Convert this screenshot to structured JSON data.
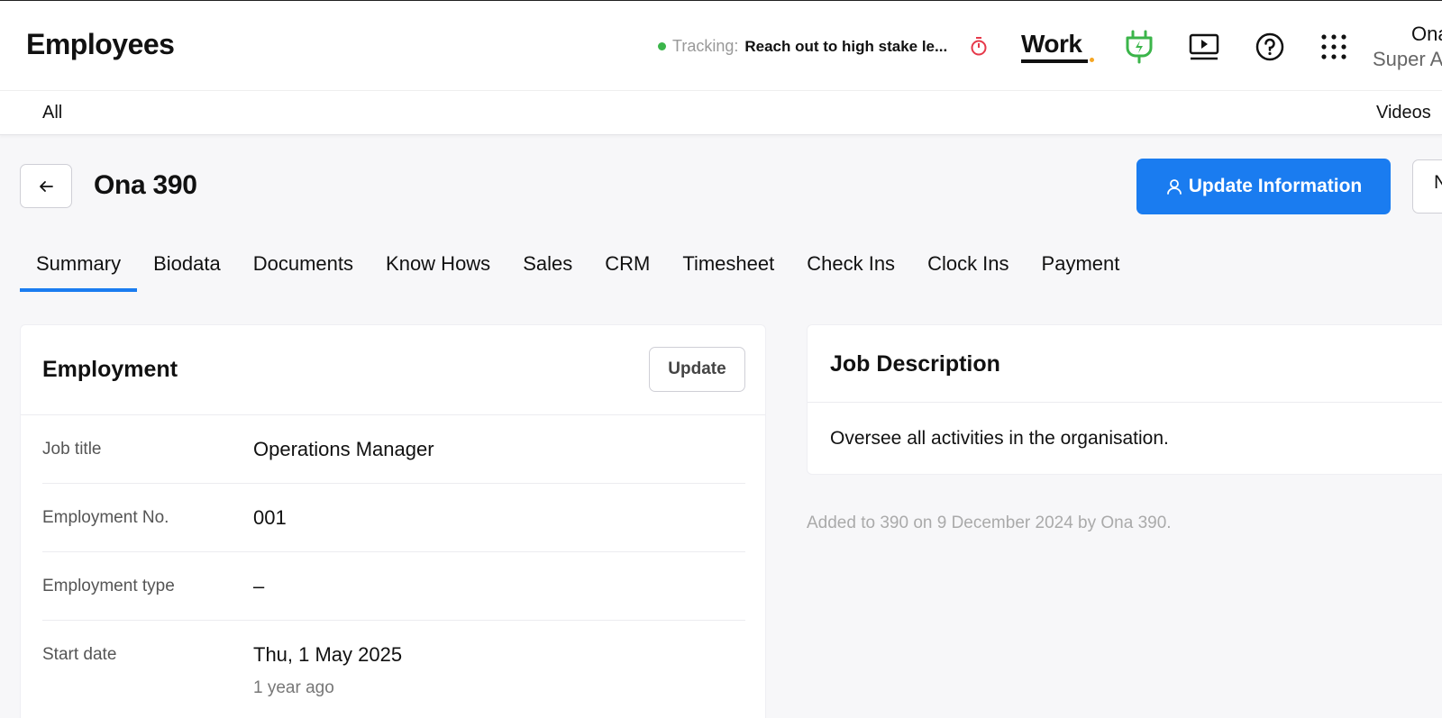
{
  "header": {
    "title": "Employees",
    "tracking_label": "Tracking:",
    "tracking_text": "Reach out to high stake le...",
    "work_logo": "Work",
    "user_name": "Ona",
    "user_role": "Super A"
  },
  "subnav": {
    "all": "All",
    "videos": "Videos"
  },
  "page": {
    "title": "Ona 390",
    "update_info_label": "Update Information",
    "next_label": "N"
  },
  "tabs": [
    "Summary",
    "Biodata",
    "Documents",
    "Know Hows",
    "Sales",
    "CRM",
    "Timesheet",
    "Check Ins",
    "Clock Ins",
    "Payment"
  ],
  "employment": {
    "title": "Employment",
    "update_label": "Update",
    "rows": [
      {
        "label": "Job title",
        "value": "Operations Manager"
      },
      {
        "label": "Employment No.",
        "value": "001"
      },
      {
        "label": "Employment type",
        "value": "–"
      },
      {
        "label": "Start date",
        "value": "Thu, 1 May 2025",
        "sub": "1 year ago"
      }
    ]
  },
  "job_description": {
    "title": "Job Description",
    "text": "Oversee all activities in the organisation."
  },
  "added_note": "Added to 390 on 9 December 2024 by Ona 390.",
  "colors": {
    "accent": "#1a7cf0",
    "tracking_dot": "#3bb54a",
    "plug_icon": "#3bb54a",
    "timer_icon": "#e6394a"
  },
  "icons": [
    "back-arrow-icon",
    "stopwatch-icon",
    "plug-icon",
    "video-play-icon",
    "help-icon",
    "apps-grid-icon",
    "user-icon"
  ]
}
